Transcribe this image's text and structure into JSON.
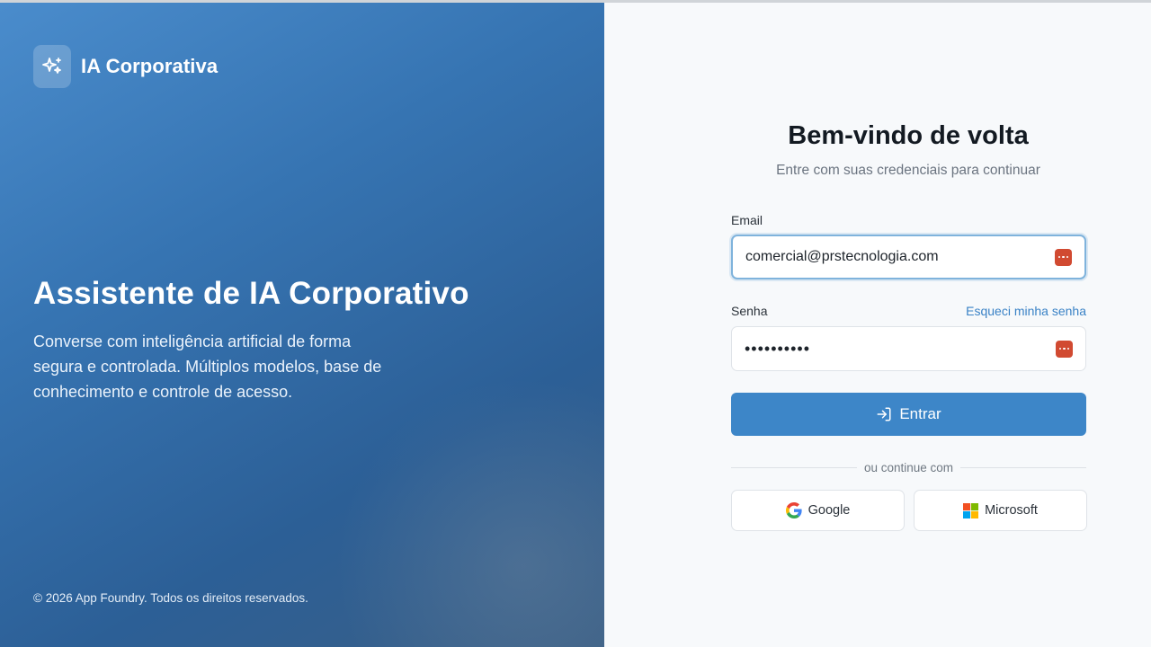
{
  "brand": {
    "name": "IA Corporativa",
    "icon": "sparkles-icon"
  },
  "hero": {
    "title": "Assistente de IA Corporativo",
    "description": "Converse com inteligência artificial de forma segura e controlada. Múltiplos modelos, base de conhecimento e controle de acesso."
  },
  "footer": {
    "copyright": "© 2026 App Foundry. Todos os direitos reservados."
  },
  "login": {
    "title": "Bem-vindo de volta",
    "subtitle": "Entre com suas credenciais para continuar",
    "email_label": "Email",
    "email_value": "comercial@prstecnologia.com",
    "password_label": "Senha",
    "password_value": "••••••••••",
    "forgot_label": "Esqueci minha senha",
    "submit_label": "Entrar",
    "divider_text": "ou continue com",
    "google_label": "Google",
    "microsoft_label": "Microsoft"
  },
  "colors": {
    "primary": "#3d86c8",
    "panel_gradient_start": "#4a8ccc",
    "panel_gradient_end": "#2c5f96",
    "link": "#3a82c6",
    "password_manager": "#d14a31"
  }
}
